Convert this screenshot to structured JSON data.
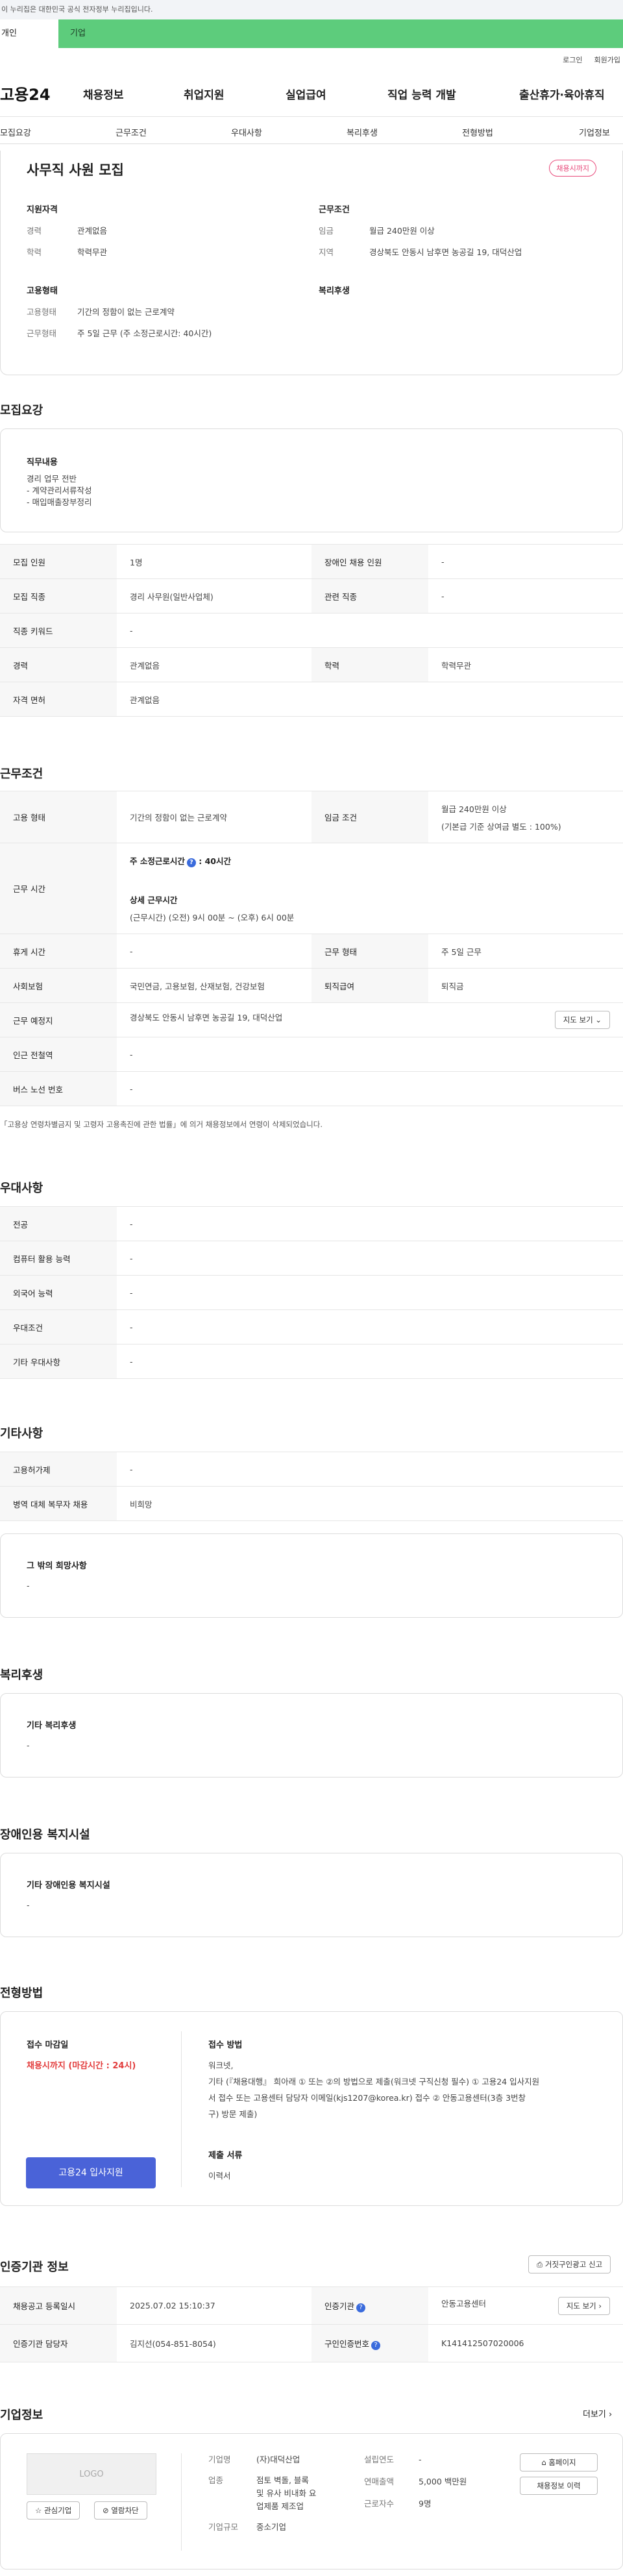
{
  "gov_banner": "이 누리집은 대한민국 공식 전자정부 누리집입니다.",
  "top_tabs": [
    "개인",
    "기업"
  ],
  "util": [
    "로그인",
    "회원가입"
  ],
  "logo": "고용24",
  "gnb": [
    "채용정보",
    "취업지원",
    "실업급여",
    "직업 능력 개발",
    "출산휴가·육아휴직"
  ],
  "anchors": [
    "모집요강",
    "근무조건",
    "우대사항",
    "복리후생",
    "전형방법",
    "기업정보"
  ],
  "summary": {
    "title": "사무직 사원 모집",
    "badge": "채용시까지",
    "qual_h": "지원자격",
    "career_k": "경력",
    "career_v": "관계없음",
    "edu_k": "학력",
    "edu_v": "학력무관",
    "work_h": "근무조건",
    "wage_k": "임금",
    "wage_v": "월급 240만원 이상",
    "region_k": "지역",
    "region_v": "경상북도 안동시 남후면 농공길 19, 대덕산업",
    "emp_h": "고용형태",
    "emptype_k": "고용형태",
    "emptype_v": "기간의 정함이 없는 근로계약",
    "worktype_k": "근무형태",
    "worktype_v": "주 5일 근무 (주 소정근로시간: 40시간)",
    "welfare_h": "복리후생"
  },
  "recruit": {
    "title": "모집요강",
    "duty_h": "직무내용",
    "duty_lines": [
      "경리 업무 전반",
      "- 계약관리서류작성",
      "- 매입매출장부정리"
    ],
    "rows": {
      "count_k": "모집 인원",
      "count_v": "1명",
      "disab_k": "장애인 채용 인원",
      "disab_v": "-",
      "job_k": "모집 직종",
      "job_v": "경리 사무원(일반사업체)",
      "rel_k": "관련 직종",
      "rel_v": "-",
      "kw_k": "직종 키워드",
      "kw_v": "-",
      "career_k": "경력",
      "career_v": "관계없음",
      "edu_k": "학력",
      "edu_v": "학력무관",
      "lic_k": "자격 면허",
      "lic_v": "관계없음"
    }
  },
  "conditions": {
    "title": "근무조건",
    "emp_k": "고용 형태",
    "emp_v": "기간의 정함이 없는 근로계약",
    "wage_k": "임금 조건",
    "wage_v1": "월급 240만원 이상",
    "wage_v2": "(기본급 기준 상여금 별도 : 100%)",
    "time_k": "근무 시간",
    "time_l1": "주 소정근로시간",
    "time_l1b": ": 40시간",
    "time_l2": "상세 근무시간",
    "time_l3": "(근무시간) (오전) 9시 00분 ~ (오후) 6시 00분",
    "rest_k": "휴게 시간",
    "rest_v": "-",
    "form_k": "근무 형태",
    "form_v": "주 5일 근무",
    "ins_k": "사회보험",
    "ins_v": "국민연금, 고용보험, 산재보험, 건강보험",
    "ret_k": "퇴직급여",
    "ret_v": "퇴직금",
    "place_k": "근무 예정지",
    "place_v": "경상북도 안동시 남후면 농공길 19, 대덕산업",
    "map_btn": "지도 보기",
    "station_k": "인근 전철역",
    "station_v": "-",
    "bus_k": "버스 노선 번호",
    "bus_v": "-",
    "note": "「고용상 연령차별금지 및 고령자 고용촉진에 관한 법률」에 의거 채용정보에서 연령이 삭제되었습니다."
  },
  "pref": {
    "title": "우대사항",
    "rows": [
      [
        "전공",
        "-"
      ],
      [
        "컴퓨터 활용 능력",
        "-"
      ],
      [
        "외국어 능력",
        "-"
      ],
      [
        "우대조건",
        "-"
      ],
      [
        "기타 우대사항",
        "-"
      ]
    ]
  },
  "other": {
    "title": "기타사항",
    "rows": [
      [
        "고용허가제",
        "-"
      ],
      [
        "병역 대체 복무자 채용",
        "비희망"
      ]
    ],
    "hope_h": "그 밖의 희망사항",
    "hope_v": "-"
  },
  "welfare": {
    "title": "복리후생",
    "h": "기타 복리후생",
    "v": "-"
  },
  "disab": {
    "title": "장애인용 복지시설",
    "h": "기타 장애인용 복지시설",
    "v": "-"
  },
  "selection": {
    "title": "전형방법",
    "deadline_h": "접수 마감일",
    "deadline_v": "채용시까지 (마감시간 : 24시)",
    "apply_btn": "고용24 입사지원",
    "method_h": "접수 방법",
    "method_lines": [
      "워크넷,",
      "기타 (『채용대행』 희아래 ① 또는 ②의 방법으로 제출(워크넷 구직신청 필수) ① 고용24 입사지원",
      "서 접수 또는 고용센터 담당자 이메일(kjs1207@korea.kr) 접수 ② 안동고용센터(3층 3번창",
      "구) 방문 제출)"
    ],
    "docs_h": "제출 서류",
    "docs_v": "이력서"
  },
  "agency": {
    "title": "인증기관 정보",
    "report_btn": "거짓구인광고 신고",
    "reg_k": "채용공고 등록일시",
    "reg_v": "2025.07.02 15:10:37",
    "org_k": "인증기관",
    "org_v": "안동고용센터",
    "map_btn": "지도 보기",
    "mgr_k": "인증기관 담당자",
    "mgr_v": "김지선(054-851-8054)",
    "id_k": "구인인증번호",
    "id_v": "K141412507020006"
  },
  "company": {
    "title": "기업정보",
    "more": "더보기",
    "logo_ph": "LOGO",
    "fav_btn": "관심기업",
    "block_btn": "열람차단",
    "name_k": "기업명",
    "name_v": "(자)대덕산업",
    "ind_k": "업종",
    "ind_lines": [
      "점토 벽돌, 블록",
      "및 유사 비내화 요",
      "업제품 제조업"
    ],
    "est_k": "설립연도",
    "est_v": "-",
    "sales_k": "연매출액",
    "sales_v": "5,000 백만원",
    "emp_k": "근로자수",
    "emp_v": "9명",
    "size_k": "기업규모",
    "size_v": "중소기업",
    "home_btn": "홈페이지",
    "hist_btn": "채용정보 이력"
  }
}
